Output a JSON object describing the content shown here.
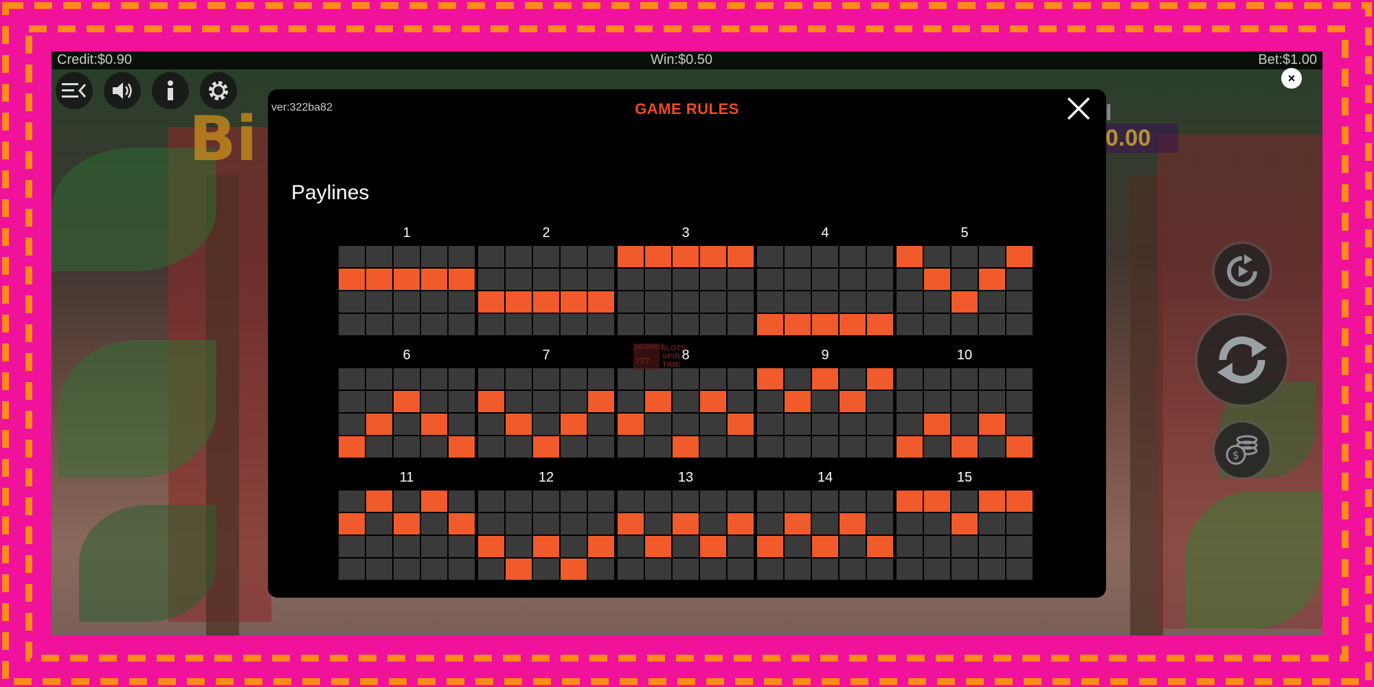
{
  "status_bar": {
    "credit": "Credit:$0.90",
    "win": "Win:$0.50",
    "bet": "Bet:$1.00"
  },
  "background": {
    "logo_partial": "Bi",
    "jackpot_label_partial": "INI",
    "jackpot_value_partial": "0.00"
  },
  "toolbar": [
    {
      "name": "menu-icon"
    },
    {
      "name": "sound-icon"
    },
    {
      "name": "info-icon"
    },
    {
      "name": "settings-icon"
    }
  ],
  "side_buttons": [
    {
      "name": "autoplay-icon"
    },
    {
      "name": "spin-icon"
    },
    {
      "name": "coins-icon"
    }
  ],
  "modal": {
    "version": "ver:322ba82",
    "title": "GAME RULES",
    "section_heading": "Paylines",
    "close_icon": "close-icon"
  },
  "watermark": {
    "line1": "JACKPOT",
    "line2": "SLOTS",
    "line3": "SPIN",
    "line4": "TIME",
    "reels": "777"
  },
  "colors": {
    "frame": "#f0129a",
    "dash": "#ff8c1a",
    "active_cell": "#f15a2b",
    "inactive_cell": "#3a3a3a",
    "title": "#ef4a23"
  },
  "paylines": [
    {
      "number": "1",
      "rows": [
        1,
        1,
        1,
        1,
        1
      ]
    },
    {
      "number": "2",
      "rows": [
        2,
        2,
        2,
        2,
        2
      ]
    },
    {
      "number": "3",
      "rows": [
        0,
        0,
        0,
        0,
        0
      ]
    },
    {
      "number": "4",
      "rows": [
        3,
        3,
        3,
        3,
        3
      ]
    },
    {
      "number": "5",
      "rows": [
        0,
        1,
        2,
        1,
        0
      ]
    },
    {
      "number": "6",
      "rows": [
        3,
        2,
        1,
        2,
        3
      ]
    },
    {
      "number": "7",
      "rows": [
        1,
        2,
        3,
        2,
        1
      ]
    },
    {
      "number": "8",
      "rows": [
        2,
        1,
        3,
        1,
        2
      ]
    },
    {
      "number": "9",
      "rows": [
        0,
        1,
        0,
        1,
        0
      ]
    },
    {
      "number": "10",
      "rows": [
        3,
        2,
        3,
        2,
        3
      ]
    },
    {
      "number": "11",
      "rows": [
        1,
        0,
        1,
        0,
        1
      ]
    },
    {
      "number": "12",
      "rows": [
        2,
        3,
        2,
        3,
        2
      ]
    },
    {
      "number": "13",
      "rows": [
        1,
        2,
        1,
        2,
        1
      ]
    },
    {
      "number": "14",
      "rows": [
        2,
        1,
        2,
        1,
        2
      ]
    },
    {
      "number": "15",
      "rows": [
        0,
        0,
        1,
        0,
        0
      ]
    }
  ]
}
